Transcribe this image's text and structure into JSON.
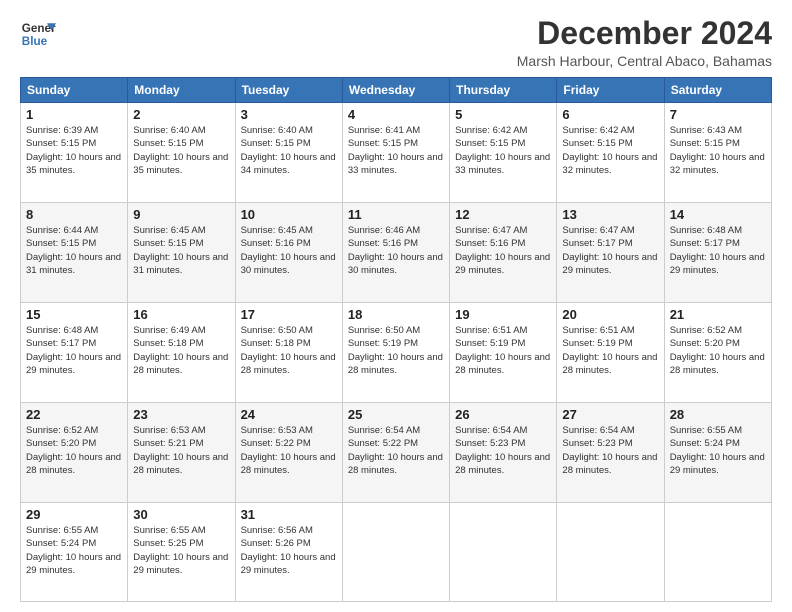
{
  "logo": {
    "line1": "General",
    "line2": "Blue"
  },
  "title": "December 2024",
  "location": "Marsh Harbour, Central Abaco, Bahamas",
  "weekdays": [
    "Sunday",
    "Monday",
    "Tuesday",
    "Wednesday",
    "Thursday",
    "Friday",
    "Saturday"
  ],
  "weeks": [
    [
      {
        "day": "1",
        "sunrise": "6:39 AM",
        "sunset": "5:15 PM",
        "daylight": "10 hours and 35 minutes."
      },
      {
        "day": "2",
        "sunrise": "6:40 AM",
        "sunset": "5:15 PM",
        "daylight": "10 hours and 35 minutes."
      },
      {
        "day": "3",
        "sunrise": "6:40 AM",
        "sunset": "5:15 PM",
        "daylight": "10 hours and 34 minutes."
      },
      {
        "day": "4",
        "sunrise": "6:41 AM",
        "sunset": "5:15 PM",
        "daylight": "10 hours and 33 minutes."
      },
      {
        "day": "5",
        "sunrise": "6:42 AM",
        "sunset": "5:15 PM",
        "daylight": "10 hours and 33 minutes."
      },
      {
        "day": "6",
        "sunrise": "6:42 AM",
        "sunset": "5:15 PM",
        "daylight": "10 hours and 32 minutes."
      },
      {
        "day": "7",
        "sunrise": "6:43 AM",
        "sunset": "5:15 PM",
        "daylight": "10 hours and 32 minutes."
      }
    ],
    [
      {
        "day": "8",
        "sunrise": "6:44 AM",
        "sunset": "5:15 PM",
        "daylight": "10 hours and 31 minutes."
      },
      {
        "day": "9",
        "sunrise": "6:45 AM",
        "sunset": "5:15 PM",
        "daylight": "10 hours and 31 minutes."
      },
      {
        "day": "10",
        "sunrise": "6:45 AM",
        "sunset": "5:16 PM",
        "daylight": "10 hours and 30 minutes."
      },
      {
        "day": "11",
        "sunrise": "6:46 AM",
        "sunset": "5:16 PM",
        "daylight": "10 hours and 30 minutes."
      },
      {
        "day": "12",
        "sunrise": "6:47 AM",
        "sunset": "5:16 PM",
        "daylight": "10 hours and 29 minutes."
      },
      {
        "day": "13",
        "sunrise": "6:47 AM",
        "sunset": "5:17 PM",
        "daylight": "10 hours and 29 minutes."
      },
      {
        "day": "14",
        "sunrise": "6:48 AM",
        "sunset": "5:17 PM",
        "daylight": "10 hours and 29 minutes."
      }
    ],
    [
      {
        "day": "15",
        "sunrise": "6:48 AM",
        "sunset": "5:17 PM",
        "daylight": "10 hours and 29 minutes."
      },
      {
        "day": "16",
        "sunrise": "6:49 AM",
        "sunset": "5:18 PM",
        "daylight": "10 hours and 28 minutes."
      },
      {
        "day": "17",
        "sunrise": "6:50 AM",
        "sunset": "5:18 PM",
        "daylight": "10 hours and 28 minutes."
      },
      {
        "day": "18",
        "sunrise": "6:50 AM",
        "sunset": "5:19 PM",
        "daylight": "10 hours and 28 minutes."
      },
      {
        "day": "19",
        "sunrise": "6:51 AM",
        "sunset": "5:19 PM",
        "daylight": "10 hours and 28 minutes."
      },
      {
        "day": "20",
        "sunrise": "6:51 AM",
        "sunset": "5:19 PM",
        "daylight": "10 hours and 28 minutes."
      },
      {
        "day": "21",
        "sunrise": "6:52 AM",
        "sunset": "5:20 PM",
        "daylight": "10 hours and 28 minutes."
      }
    ],
    [
      {
        "day": "22",
        "sunrise": "6:52 AM",
        "sunset": "5:20 PM",
        "daylight": "10 hours and 28 minutes."
      },
      {
        "day": "23",
        "sunrise": "6:53 AM",
        "sunset": "5:21 PM",
        "daylight": "10 hours and 28 minutes."
      },
      {
        "day": "24",
        "sunrise": "6:53 AM",
        "sunset": "5:22 PM",
        "daylight": "10 hours and 28 minutes."
      },
      {
        "day": "25",
        "sunrise": "6:54 AM",
        "sunset": "5:22 PM",
        "daylight": "10 hours and 28 minutes."
      },
      {
        "day": "26",
        "sunrise": "6:54 AM",
        "sunset": "5:23 PM",
        "daylight": "10 hours and 28 minutes."
      },
      {
        "day": "27",
        "sunrise": "6:54 AM",
        "sunset": "5:23 PM",
        "daylight": "10 hours and 28 minutes."
      },
      {
        "day": "28",
        "sunrise": "6:55 AM",
        "sunset": "5:24 PM",
        "daylight": "10 hours and 29 minutes."
      }
    ],
    [
      {
        "day": "29",
        "sunrise": "6:55 AM",
        "sunset": "5:24 PM",
        "daylight": "10 hours and 29 minutes."
      },
      {
        "day": "30",
        "sunrise": "6:55 AM",
        "sunset": "5:25 PM",
        "daylight": "10 hours and 29 minutes."
      },
      {
        "day": "31",
        "sunrise": "6:56 AM",
        "sunset": "5:26 PM",
        "daylight": "10 hours and 29 minutes."
      },
      null,
      null,
      null,
      null
    ]
  ]
}
